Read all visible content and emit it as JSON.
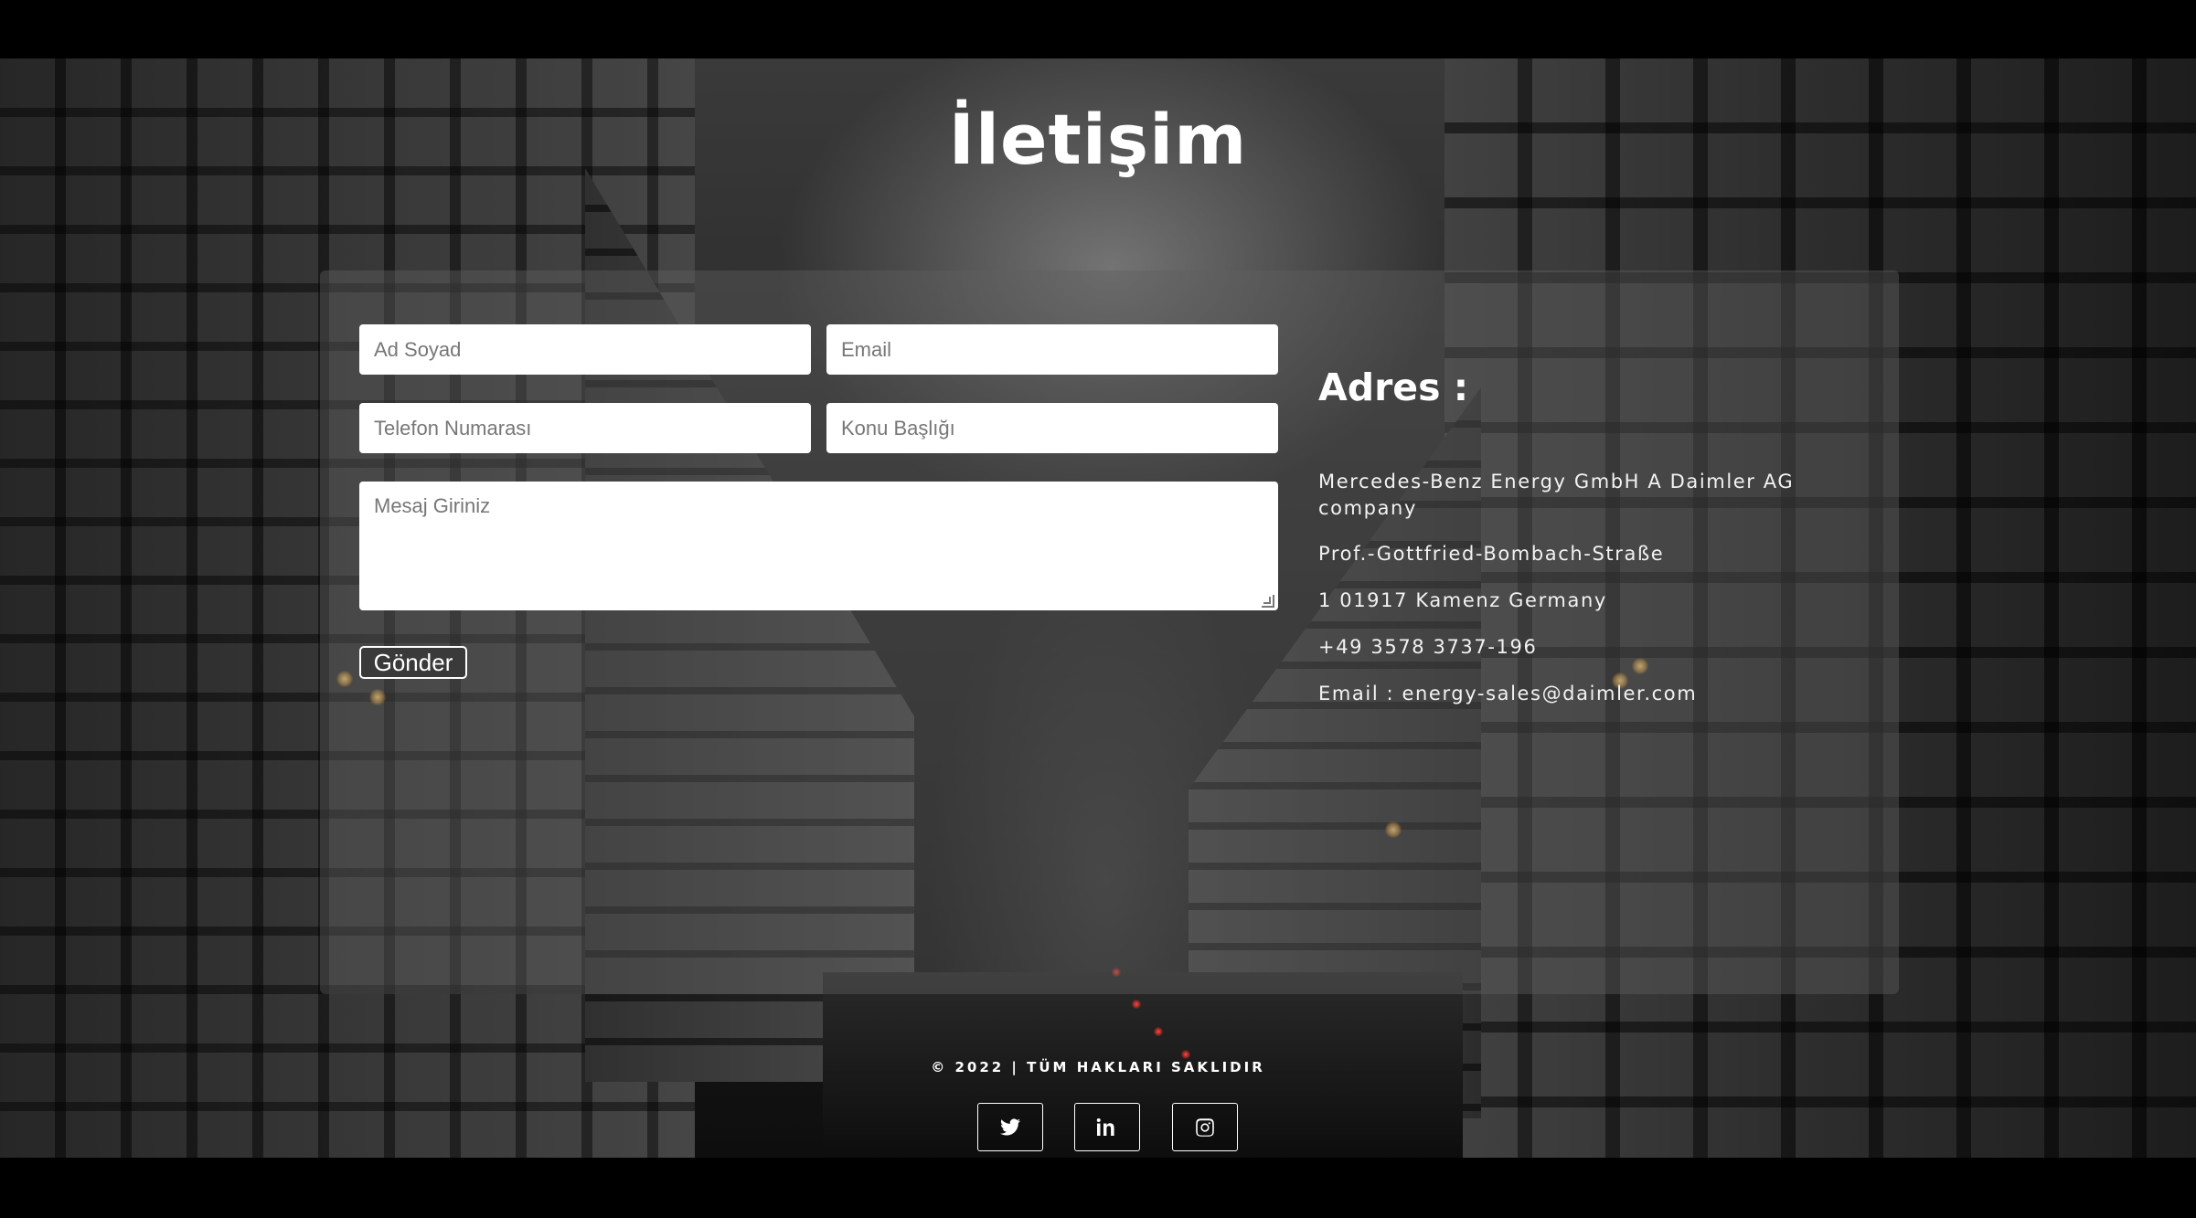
{
  "page": {
    "title": "İletişim"
  },
  "form": {
    "name_placeholder": "Ad Soyad",
    "email_placeholder": "Email",
    "phone_placeholder": "Telefon Numarası",
    "subject_placeholder": "Konu Başlığı",
    "message_placeholder": "Mesaj Giriniz",
    "submit_label": "Gönder"
  },
  "address": {
    "heading": "Adres :",
    "lines": [
      "Mercedes-Benz Energy GmbH A Daimler AG company",
      "Prof.-Gottfried-Bombach-Straße",
      "1 01917 Kamenz Germany",
      "+49 3578 3737-196",
      "Email : energy-sales@daimler.com"
    ]
  },
  "footer": {
    "copyright": "© 2022 | TÜM HAKLARI SAKLIDIR",
    "social": [
      {
        "icon": "twitter-icon"
      },
      {
        "icon": "linkedin-icon"
      },
      {
        "icon": "instagram-icon"
      }
    ]
  },
  "colors": {
    "panel_overlay": "#5f5f5f",
    "text": "#ffffff",
    "background": "#000000"
  }
}
